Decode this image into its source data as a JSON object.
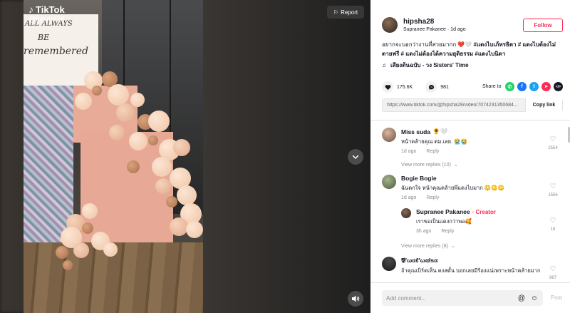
{
  "video": {
    "logo_text": "TikTok",
    "handle": "@hipsha28",
    "sign_line1": "ALL ALWAYS",
    "sign_line2": "BE",
    "sign_line3": "remembered",
    "report_label": "Report"
  },
  "author": {
    "username": "hipsha28",
    "display_name": "Supranee Pakanee",
    "time": "1d ago",
    "follow_label": "Follow"
  },
  "caption": {
    "text": "อยากจะบอกว่างานที่สวยมากก ❤️🤍 ",
    "tags": "#แดงไบเภ้ทรธิดา # แดงไบต้องไม่ตายฟรี # แดงไม่ต้องได้ความยุติธรรม #แดงไบนิดา"
  },
  "music": {
    "title": "เสียงต้นฉบับ - วง Sisters' Time"
  },
  "stats": {
    "likes": "175.6K",
    "comments": "981",
    "share_label": "Share to"
  },
  "share_icons": [
    {
      "name": "whatsapp-icon",
      "glyph": "✆",
      "color": "#25d366"
    },
    {
      "name": "facebook-icon",
      "glyph": "f",
      "color": "#1877f2"
    },
    {
      "name": "twitter-icon",
      "glyph": "t",
      "color": "#1da1f2"
    },
    {
      "name": "send-icon",
      "glyph": "➤",
      "color": "#fe2c55"
    },
    {
      "name": "embed-icon",
      "glyph": "</>",
      "color": "#161823"
    }
  ],
  "link": {
    "url": "https://www.tiktok.com/@hipsha28/video/7074231350684...",
    "copy_label": "Copy link"
  },
  "comments": [
    {
      "username": "Miss suda",
      "badge": "🌻🤍",
      "text": "หน้าคล้ายคุณ ตม.เลย. 😭😭",
      "time": "1d ago",
      "reply_label": "Reply",
      "likes": "2554",
      "more_replies": "View more replies (10)"
    },
    {
      "username": "Bogie Bogie",
      "text": "ฉันตกใจ หน้าคุณคล้ายพี่แดงไบมาก 😳😳😳",
      "time": "1d ago",
      "reply_label": "Reply",
      "likes": "1556"
    },
    {
      "username": "Supranee Pakanee",
      "creator_label": "· Creator",
      "text": "เราขอเป็นแดงกว่าพอ🥰",
      "time": "3h ago",
      "reply_label": "Reply",
      "likes": "19",
      "more_replies": "View more replies (8)"
    },
    {
      "username": "𝕻'ωαℓ'ωαłѕα",
      "text": "ถ้าคุณเบิร์ดเห็น คงสดั้น บอกเลยมีร้องแน่เพราะหน้าคล้ายมาก",
      "likes": "967"
    }
  ],
  "comment_bar": {
    "placeholder": "Add comment...",
    "post_label": "Post"
  }
}
